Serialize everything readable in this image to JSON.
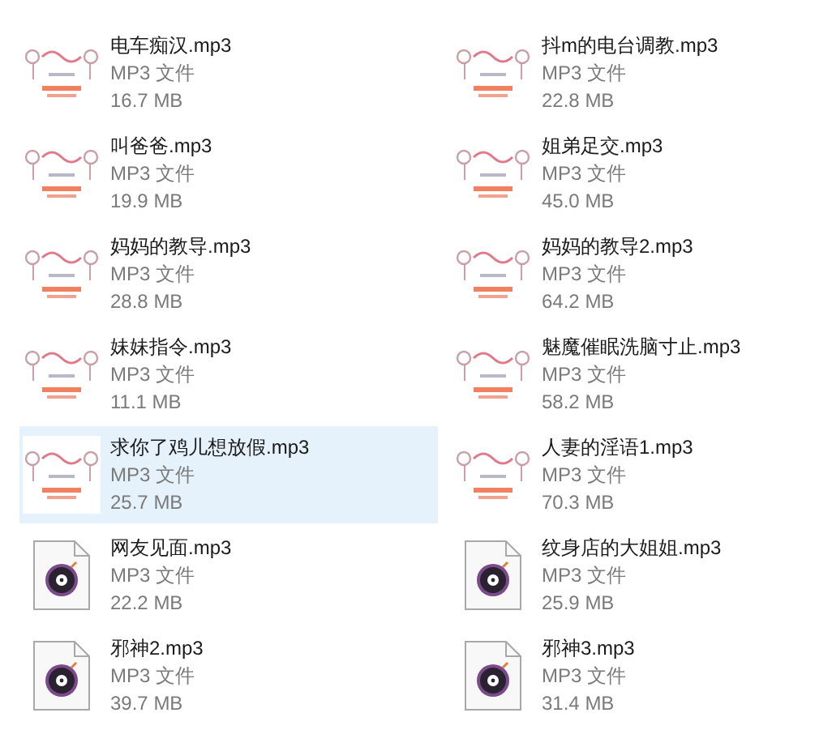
{
  "files": [
    {
      "name": "电车痴汉.mp3",
      "type": "MP3 文件",
      "size": "16.7 MB",
      "kind": "thumbnail",
      "selected": false
    },
    {
      "name": "抖m的电台调教.mp3",
      "type": "MP3 文件",
      "size": "22.8 MB",
      "kind": "thumbnail",
      "selected": false
    },
    {
      "name": "叫爸爸.mp3",
      "type": "MP3 文件",
      "size": "19.9 MB",
      "kind": "thumbnail",
      "selected": false
    },
    {
      "name": "姐弟足交.mp3",
      "type": "MP3 文件",
      "size": "45.0 MB",
      "kind": "thumbnail",
      "selected": false
    },
    {
      "name": "妈妈的教导.mp3",
      "type": "MP3 文件",
      "size": "28.8 MB",
      "kind": "thumbnail",
      "selected": false
    },
    {
      "name": "妈妈的教导2.mp3",
      "type": "MP3 文件",
      "size": "64.2 MB",
      "kind": "thumbnail",
      "selected": false
    },
    {
      "name": "妹妹指令.mp3",
      "type": "MP3 文件",
      "size": "11.1 MB",
      "kind": "thumbnail",
      "selected": false
    },
    {
      "name": "魅魔催眠洗脑寸止.mp3",
      "type": "MP3 文件",
      "size": "58.2 MB",
      "kind": "thumbnail",
      "selected": false
    },
    {
      "name": "求你了鸡儿想放假.mp3",
      "type": "MP3 文件",
      "size": "25.7 MB",
      "kind": "thumbnail",
      "selected": true
    },
    {
      "name": "人妻的淫语1.mp3",
      "type": "MP3 文件",
      "size": "70.3 MB",
      "kind": "thumbnail",
      "selected": false
    },
    {
      "name": "网友见面.mp3",
      "type": "MP3 文件",
      "size": "22.2 MB",
      "kind": "audio",
      "selected": false
    },
    {
      "name": "纹身店的大姐姐.mp3",
      "type": "MP3 文件",
      "size": "25.9 MB",
      "kind": "audio",
      "selected": false
    },
    {
      "name": "邪神2.mp3",
      "type": "MP3 文件",
      "size": "39.7 MB",
      "kind": "audio",
      "selected": false
    },
    {
      "name": "邪神3.mp3",
      "type": "MP3 文件",
      "size": "31.4 MB",
      "kind": "audio",
      "selected": false
    }
  ]
}
